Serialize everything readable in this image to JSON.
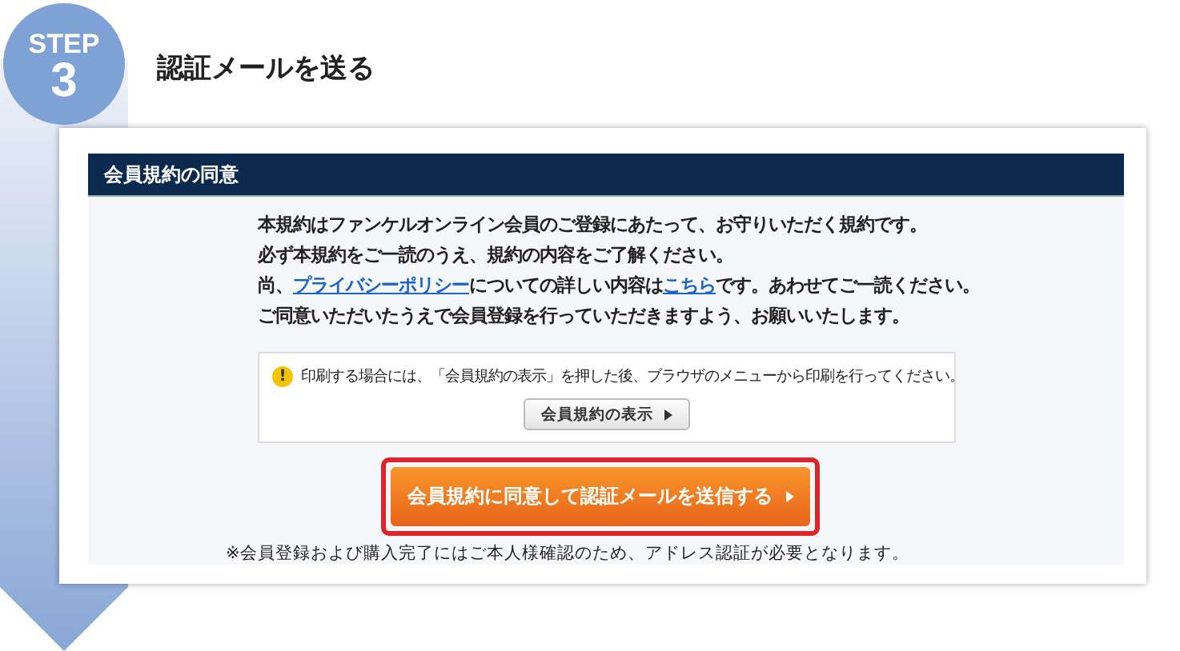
{
  "step": {
    "label": "STEP",
    "number": "3"
  },
  "title": "認証メールを送る",
  "panel": {
    "heading": "会員規約の同意",
    "lines": [
      [
        {
          "kind": "text",
          "text": "本規約はファンケルオンライン会員のご登録にあたって、お守りいただく規約です。"
        }
      ],
      [
        {
          "kind": "text",
          "text": "必ず本規約をご一読のうえ、規約の内容をご了解ください。"
        }
      ],
      [
        {
          "kind": "text",
          "text": "尚、"
        },
        {
          "kind": "link",
          "text": "プライバシーポリシー"
        },
        {
          "kind": "text",
          "text": "についての詳しい内容は"
        },
        {
          "kind": "link",
          "text": "こちら"
        },
        {
          "kind": "text",
          "text": "です。あわせてご一読ください。"
        }
      ],
      [
        {
          "kind": "text",
          "text": "ご同意いただいたうえで会員登録を行っていただきますよう、お願いいたします。"
        }
      ]
    ],
    "notice": {
      "icon": "!",
      "text": "印刷する場合には、「会員規約の表示」を押した後、ブラウザのメニューから印刷を行ってください。",
      "button": "会員規約の表示"
    },
    "submit": {
      "label": "会員規約に同意して認証メールを送信する",
      "focused": true
    },
    "footnote": "※会員登録および購入完了にはご本人様確認のため、アドレス認証が必要となります。"
  }
}
